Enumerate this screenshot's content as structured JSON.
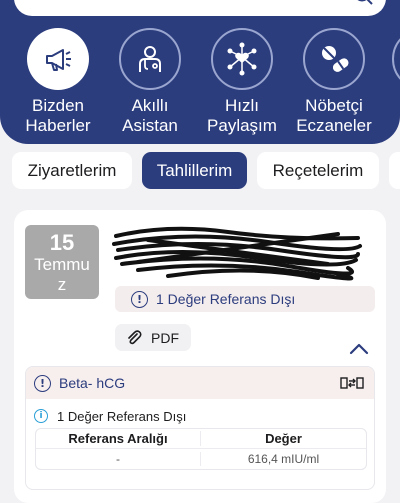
{
  "quick_actions": [
    {
      "line1": "Bizden",
      "line2": "Haberler",
      "icon": "megaphone-icon"
    },
    {
      "line1": "Akıllı",
      "line2": "Asistan",
      "icon": "doctor-icon"
    },
    {
      "line1": "Hızlı",
      "line2": "Paylaşım",
      "icon": "share-network-icon"
    },
    {
      "line1": "Nöbetçi",
      "line2": "Eczaneler",
      "icon": "pills-icon"
    }
  ],
  "tabs": [
    {
      "label": "Ziyaretlerim",
      "active": false
    },
    {
      "label": "Tahlillerim",
      "active": true
    },
    {
      "label": "Reçetelerim",
      "active": false
    }
  ],
  "result_card": {
    "date_day": "15",
    "date_month_line1": "Temmu",
    "date_month_line2": "z",
    "warning": "1 Değer Referans Dışı",
    "pdf_label": "PDF"
  },
  "test": {
    "name": "Beta- hCG",
    "info": "1 Değer Referans Dışı",
    "columns": [
      "Referans Aralığı",
      "Değer"
    ],
    "row": [
      "-",
      "616,4 mIU/ml"
    ]
  },
  "colors": {
    "primary": "#2c3d7e",
    "info": "#2a9fd6",
    "date_box": "#a9a9a9"
  }
}
